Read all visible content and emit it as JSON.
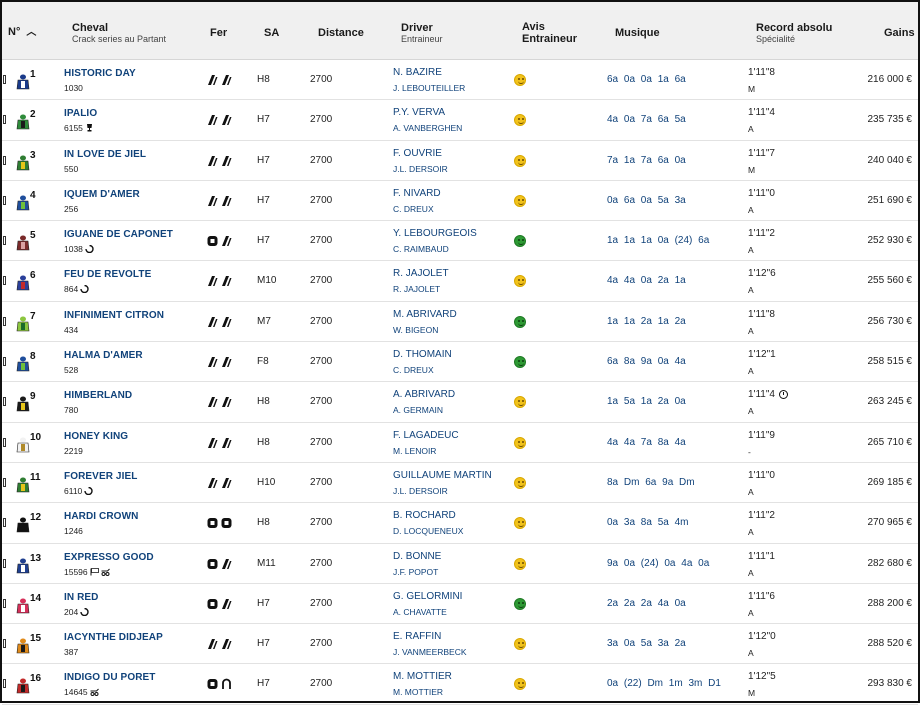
{
  "header": {
    "num": "N°",
    "horse": "Cheval",
    "horse_sub": "Crack series au Partant",
    "fer": "Fer",
    "sa": "SA",
    "distance": "Distance",
    "driver": "Driver",
    "driver_sub": "Entraineur",
    "avis_line1": "Avis",
    "avis_line2": "Entraineur",
    "musique": "Musique",
    "record": "Record absolu",
    "record_sub": "Spécialité",
    "gains": "Gains"
  },
  "colors": {
    "link": "#10427a",
    "avis_neutral": "#f1c21b",
    "avis_positive": "#2e9a34"
  },
  "rows": [
    {
      "num": "1",
      "name": "HISTORIC DAY",
      "gains_count": "1030",
      "badges": [],
      "fer": [
        "D4-icon",
        "D4-icon"
      ],
      "sa": "H8",
      "distance": "2700",
      "driver": "N. BAZIRE",
      "trainer": "J. LEBOUTEILLER",
      "avis": "yellow",
      "musique": "6a  0a  0a  1a  6a",
      "record": "1'11\"8",
      "spec": "M",
      "clock": false,
      "gains": "216 000 €",
      "silk": [
        "#1a3a8a",
        "#ffffff"
      ]
    },
    {
      "num": "2",
      "name": "IPALIO",
      "gains_count": "6155",
      "badges": [
        "trophy-icon"
      ],
      "fer": [
        "D4-icon",
        "D4-icon"
      ],
      "sa": "H7",
      "distance": "2700",
      "driver": "P.Y. VERVA",
      "trainer": "A. VANBERGHEN",
      "avis": "yellow",
      "musique": "4a  0a  7a  6a  5a",
      "record": "1'11\"4",
      "spec": "A",
      "clock": false,
      "gains": "235 735 €",
      "silk": [
        "#2e8b3a",
        "#1a1a1a"
      ]
    },
    {
      "num": "3",
      "name": "IN LOVE DE JIEL",
      "gains_count": "550",
      "badges": [],
      "fer": [
        "D4-icon",
        "D4-icon"
      ],
      "sa": "H7",
      "distance": "2700",
      "driver": "F. OUVRIE",
      "trainer": "J.L. DERSOIR",
      "avis": "yellow",
      "musique": "7a  1a  7a  6a  0a",
      "record": "1'11\"7",
      "spec": "M",
      "clock": false,
      "gains": "240 040 €",
      "silk": [
        "#2f7d32",
        "#e6c51a"
      ]
    },
    {
      "num": "4",
      "name": "IQUEM D'AMER",
      "gains_count": "256",
      "badges": [],
      "fer": [
        "D4-icon",
        "D4-icon"
      ],
      "sa": "H7",
      "distance": "2700",
      "driver": "F. NIVARD",
      "trainer": "C. DREUX",
      "avis": "yellow",
      "musique": "0a  6a  0a  5a  3a",
      "record": "1'11\"0",
      "spec": "A",
      "clock": false,
      "gains": "251 690 €",
      "silk": [
        "#1f4e9c",
        "#6fbf3a"
      ]
    },
    {
      "num": "5",
      "name": "IGUANE DE CAPONET",
      "gains_count": "1038",
      "badges": [
        "shoe-icon"
      ],
      "fer": [
        "DA-icon",
        "D4-icon"
      ],
      "sa": "H7",
      "distance": "2700",
      "driver": "Y. LEBOURGEOIS",
      "trainer": "C. RAIMBAUD",
      "avis": "green",
      "musique": "1a  1a  1a  0a  (24)  6a",
      "record": "1'11\"2",
      "spec": "A",
      "clock": false,
      "gains": "252 930 €",
      "silk": [
        "#7a2a2a",
        "#d9a0a0"
      ]
    },
    {
      "num": "6",
      "name": "FEU DE REVOLTE",
      "gains_count": "864",
      "badges": [
        "shoe-icon"
      ],
      "fer": [
        "D4-icon",
        "D4-icon"
      ],
      "sa": "M10",
      "distance": "2700",
      "driver": "R. JAJOLET",
      "trainer": "R. JAJOLET",
      "avis": "yellow",
      "musique": "4a  4a  0a  2a  1a",
      "record": "1'12\"6",
      "spec": "A",
      "clock": false,
      "gains": "255 560 €",
      "silk": [
        "#2a3f9a",
        "#c22a2a"
      ]
    },
    {
      "num": "7",
      "name": "INFINIMENT CITRON",
      "gains_count": "434",
      "badges": [],
      "fer": [
        "D4-icon",
        "D4-icon"
      ],
      "sa": "M7",
      "distance": "2700",
      "driver": "M. ABRIVARD",
      "trainer": "W. BIGEON",
      "avis": "green",
      "musique": "1a  1a  2a  1a  2a",
      "record": "1'11\"8",
      "spec": "A",
      "clock": false,
      "gains": "256 730 €",
      "silk": [
        "#8cc63f",
        "#1a6a2a"
      ]
    },
    {
      "num": "8",
      "name": "HALMA D'AMER",
      "gains_count": "528",
      "badges": [],
      "fer": [
        "D4-icon",
        "D4-icon"
      ],
      "sa": "F8",
      "distance": "2700",
      "driver": "D. THOMAIN",
      "trainer": "C. DREUX",
      "avis": "green",
      "musique": "6a  8a  9a  0a  4a",
      "record": "1'12\"1",
      "spec": "A",
      "clock": false,
      "gains": "258 515 €",
      "silk": [
        "#1f4e9c",
        "#6fbf3a"
      ]
    },
    {
      "num": "9",
      "name": "HIMBERLAND",
      "gains_count": "780",
      "badges": [],
      "fer": [
        "D4-icon",
        "D4-icon"
      ],
      "sa": "H8",
      "distance": "2700",
      "driver": "A. ABRIVARD",
      "trainer": "A. GERMAIN",
      "avis": "yellow",
      "musique": "1a  5a  1a  2a  0a",
      "record": "1'11\"4",
      "spec": "A",
      "clock": true,
      "gains": "263 245 €",
      "silk": [
        "#1a1a1a",
        "#e6c51a"
      ]
    },
    {
      "num": "10",
      "name": "HONEY KING",
      "gains_count": "2219",
      "badges": [],
      "fer": [
        "D4-icon",
        "D4-icon"
      ],
      "sa": "H8",
      "distance": "2700",
      "driver": "F. LAGADEUC",
      "trainer": "M. LENOIR",
      "avis": "yellow",
      "musique": "4a  4a  7a  8a  4a",
      "record": "1'11\"9",
      "spec": "-",
      "clock": false,
      "gains": "265 710 €",
      "silk": [
        "#f2f2f2",
        "#b08a2a"
      ]
    },
    {
      "num": "11",
      "name": "FOREVER JIEL",
      "gains_count": "6110",
      "badges": [
        "shoe-icon"
      ],
      "fer": [
        "D4-icon",
        "D4-icon"
      ],
      "sa": "H10",
      "distance": "2700",
      "driver": "GUILLAUME MARTIN",
      "trainer": "J.L. DERSOIR",
      "avis": "yellow",
      "musique": "8a  Dm  6a  9a  Dm",
      "record": "1'11\"0",
      "spec": "A",
      "clock": false,
      "gains": "269 185 €",
      "silk": [
        "#2f7d32",
        "#e6c51a"
      ]
    },
    {
      "num": "12",
      "name": "HARDI CROWN",
      "gains_count": "1246",
      "badges": [],
      "fer": [
        "DA-icon",
        "DA-icon"
      ],
      "sa": "H8",
      "distance": "2700",
      "driver": "B. ROCHARD",
      "trainer": "D. LOCQUENEUX",
      "avis": "yellow",
      "musique": "0a  3a  8a  5a  4m",
      "record": "1'11\"2",
      "spec": "A",
      "clock": false,
      "gains": "270 965 €",
      "silk": [
        "#111111",
        "#111111"
      ]
    },
    {
      "num": "13",
      "name": "EXPRESSO GOOD",
      "gains_count": "15596",
      "badges": [
        "flag-icon",
        "cart-icon"
      ],
      "fer": [
        "DA-icon",
        "D4-icon"
      ],
      "sa": "M11",
      "distance": "2700",
      "driver": "D. BONNE",
      "trainer": "J.F. POPOT",
      "avis": "yellow",
      "musique": "9a  0a  (24)  0a  4a  0a",
      "record": "1'11\"1",
      "spec": "A",
      "clock": false,
      "gains": "282 680 €",
      "silk": [
        "#1f3f8f",
        "#ffffff"
      ]
    },
    {
      "num": "14",
      "name": "IN RED",
      "gains_count": "204",
      "badges": [
        "shoe-icon"
      ],
      "fer": [
        "DA-icon",
        "D4-icon"
      ],
      "sa": "H7",
      "distance": "2700",
      "driver": "G. GELORMINI",
      "trainer": "A. CHAVATTE",
      "avis": "green",
      "musique": "2a  2a  2a  4a  0a",
      "record": "1'11\"6",
      "spec": "A",
      "clock": false,
      "gains": "288 200 €",
      "silk": [
        "#d6305a",
        "#ffffff"
      ]
    },
    {
      "num": "15",
      "name": "IACYNTHE DIDJEAP",
      "gains_count": "387",
      "badges": [],
      "fer": [
        "D4-icon",
        "D4-icon"
      ],
      "sa": "H7",
      "distance": "2700",
      "driver": "E. RAFFIN",
      "trainer": "J. VANMEERBECK",
      "avis": "yellow",
      "musique": "3a  0a  5a  3a  2a",
      "record": "1'12\"0",
      "spec": "A",
      "clock": false,
      "gains": "288 520 €",
      "silk": [
        "#e08a1a",
        "#1a1a1a"
      ]
    },
    {
      "num": "16",
      "name": "INDIGO DU PORET",
      "gains_count": "14645",
      "badges": [
        "cart-icon"
      ],
      "fer": [
        "DA-icon",
        "DP-icon"
      ],
      "sa": "H7",
      "distance": "2700",
      "driver": "M. MOTTIER",
      "trainer": "M. MOTTIER",
      "avis": "yellow",
      "musique": "0a  (22)  Dm  1m  3m  D1",
      "record": "1'12\"5",
      "spec": "M",
      "clock": false,
      "gains": "293 830 €",
      "silk": [
        "#c22a2a",
        "#1a1a1a"
      ]
    }
  ]
}
